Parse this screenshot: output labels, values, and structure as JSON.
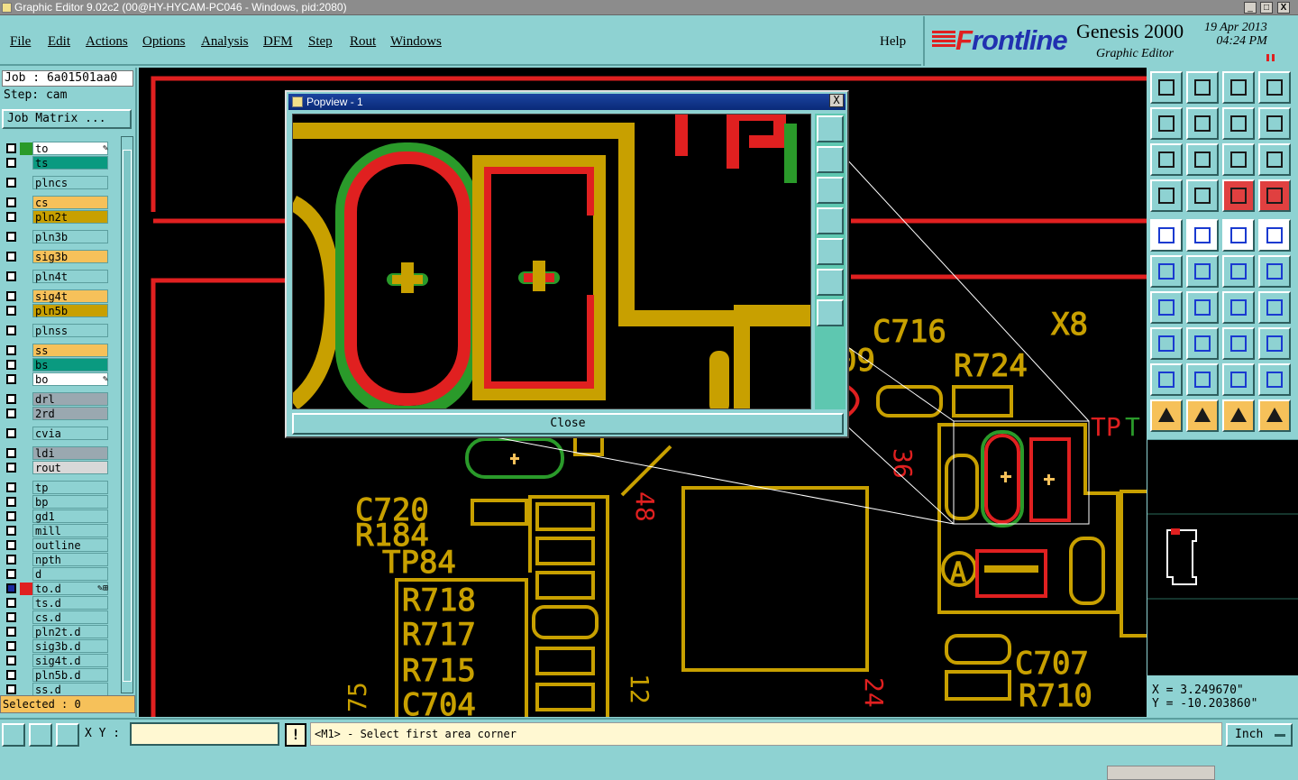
{
  "window": {
    "title": "Graphic Editor 9.02c2 (00@HY-HYCAM-PC046 - Windows, pid:2080)",
    "minimize": "_",
    "maximize": "□",
    "close": "X"
  },
  "menu": {
    "items": [
      "File",
      "Edit",
      "Actions",
      "Options",
      "Analysis",
      "DFM",
      "Step",
      "Rout",
      "Windows"
    ],
    "help": "Help"
  },
  "brand": {
    "logo_first": "F",
    "logo_rest": "rontline",
    "product": "Genesis 2000",
    "subtitle": "Graphic Editor",
    "date": "19 Apr 2013",
    "time": "04:24 PM"
  },
  "job": {
    "job_line": "Job : 6a01501aa0",
    "step_line": "Step: cam",
    "matrix_button": "Job Matrix ..."
  },
  "colors": {
    "board": "#f6c15a",
    "signal": "#f6c15a",
    "mask": "#0a9a80",
    "drill": "#9aa8b0",
    "misc": "#8ed2d2",
    "white": "#ffffff",
    "red": "#e02020",
    "green": "#2a9a2a",
    "copper": "#c8a000"
  },
  "layers": [
    {
      "name": "to",
      "kind": "white",
      "sw": "green",
      "mark": "✎"
    },
    {
      "name": "ts",
      "kind": "mask",
      "sw": "",
      "mark": ""
    },
    {
      "name": "plncs",
      "kind": "misc",
      "sw": "",
      "mark": ""
    },
    {
      "name": "cs",
      "kind": "board",
      "sw": "",
      "mark": ""
    },
    {
      "name": "pln2t",
      "kind": "copper",
      "sw": "",
      "mark": ""
    },
    {
      "name": "pln3b",
      "kind": "misc",
      "sw": "",
      "mark": ""
    },
    {
      "name": "sig3b",
      "kind": "board",
      "sw": "",
      "mark": ""
    },
    {
      "name": "pln4t",
      "kind": "misc",
      "sw": "",
      "mark": ""
    },
    {
      "name": "sig4t",
      "kind": "board",
      "sw": "",
      "mark": ""
    },
    {
      "name": "pln5b",
      "kind": "copper",
      "sw": "",
      "mark": ""
    },
    {
      "name": "plnss",
      "kind": "misc",
      "sw": "",
      "mark": ""
    },
    {
      "name": "ss",
      "kind": "board",
      "sw": "",
      "mark": ""
    },
    {
      "name": "bs",
      "kind": "mask",
      "sw": "",
      "mark": ""
    },
    {
      "name": "bo",
      "kind": "white",
      "sw": "",
      "mark": "✎"
    },
    {
      "name": "drl",
      "kind": "drill",
      "sw": "",
      "mark": ""
    },
    {
      "name": "2rd",
      "kind": "drill",
      "sw": "",
      "mark": ""
    },
    {
      "name": "cvia",
      "kind": "misc",
      "sw": "",
      "mark": ""
    },
    {
      "name": "ldi",
      "kind": "drill",
      "sw": "",
      "mark": ""
    },
    {
      "name": "rout",
      "kind": "light",
      "sw": "",
      "mark": ""
    },
    {
      "name": "tp",
      "kind": "misc",
      "sw": "",
      "mark": ""
    },
    {
      "name": "bp",
      "kind": "misc",
      "sw": "",
      "mark": ""
    },
    {
      "name": "gd1",
      "kind": "misc",
      "sw": "",
      "mark": ""
    },
    {
      "name": "mill",
      "kind": "misc",
      "sw": "",
      "mark": ""
    },
    {
      "name": "outline",
      "kind": "misc",
      "sw": "",
      "mark": ""
    },
    {
      "name": "npth",
      "kind": "misc",
      "sw": "",
      "mark": ""
    },
    {
      "name": "d",
      "kind": "misc",
      "sw": "",
      "mark": ""
    },
    {
      "name": "to.d",
      "kind": "misc",
      "sw": "red",
      "mark": "✎⊞",
      "active": true
    },
    {
      "name": "ts.d",
      "kind": "misc",
      "sw": "",
      "mark": ""
    },
    {
      "name": "cs.d",
      "kind": "misc",
      "sw": "",
      "mark": ""
    },
    {
      "name": "pln2t.d",
      "kind": "misc",
      "sw": "",
      "mark": ""
    },
    {
      "name": "sig3b.d",
      "kind": "misc",
      "sw": "",
      "mark": ""
    },
    {
      "name": "sig4t.d",
      "kind": "misc",
      "sw": "",
      "mark": ""
    },
    {
      "name": "pln5b.d",
      "kind": "misc",
      "sw": "",
      "mark": ""
    },
    {
      "name": "ss.d",
      "kind": "misc",
      "sw": "",
      "mark": ""
    }
  ],
  "selected": "Selected : 0",
  "canvas_labels": {
    "c716": "C716",
    "x8": "X8",
    "r724": "R724",
    "tp": "TP",
    "t": "T",
    "n09": "09",
    "c720": "C720",
    "r184": "R184",
    "tp84": "TP84",
    "r718": "R718",
    "r717": "R717",
    "r715": "R715",
    "c704": "C704",
    "n75": "75",
    "n12": "12",
    "n48": "48",
    "n36": "36",
    "a": "A",
    "c707": "C707",
    "r710": "R710",
    "n24": "24"
  },
  "popview": {
    "title": "Popview - 1",
    "close_label": "Close",
    "x_label": "X"
  },
  "coords": {
    "x": "X = 3.249670\"",
    "y": "Y = -10.203860\""
  },
  "status": {
    "xy_label": "X Y :",
    "xy_value": "",
    "bang": "!",
    "prompt": "<M1> - Select first area corner",
    "units": "Inch"
  },
  "toolbar_icons": [
    "zoom-home-icon",
    "zoom-up-icon",
    "home-icon",
    "window-icon",
    "pan-left-icon",
    "pan-right-icon",
    "undo-pan-icon",
    "redo-icon",
    "fit-icon",
    "center-icon",
    "one-to-one-icon",
    "help-icon",
    "measure-icon",
    "grid-icon",
    "layers-icon",
    "layers-alt-icon",
    "feature-select-icon",
    "net-icon",
    "ruler-icon",
    "pad-icon",
    "connect-icon",
    "delete-icon",
    "snap-icon",
    "snap-alt-icon",
    "line-icon",
    "line-alt-icon",
    "arc-icon",
    "text-icon",
    "pad-add-icon",
    "cut-icon",
    "resize-icon",
    "group-icon",
    "triangle-icon",
    "triangle-alt-icon",
    "fill-icon",
    "fill-alt-icon",
    "pointer-icon",
    "pointer-red-icon",
    "pointer-orange-icon",
    "route-icon"
  ]
}
